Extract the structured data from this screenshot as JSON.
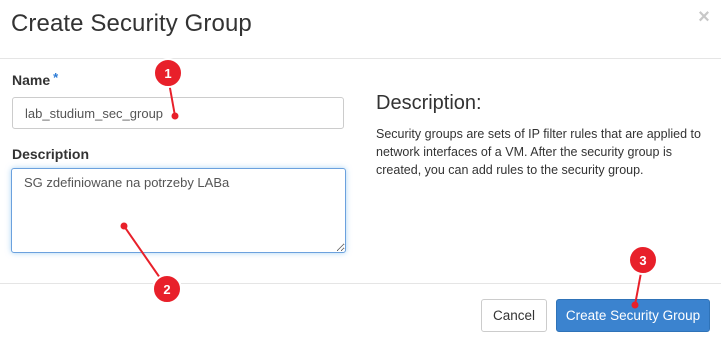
{
  "modal": {
    "title": "Create Security Group",
    "close_icon": "close-icon"
  },
  "form": {
    "name": {
      "label": "Name",
      "required_marker": "*",
      "value": "lab_studium_sec_group"
    },
    "description": {
      "label": "Description",
      "value": "SG zdefiniowane na potrzeby LABa"
    }
  },
  "help": {
    "heading": "Description:",
    "text": "Security groups are sets of IP filter rules that are applied to network interfaces of a VM. After the security group is created, you can add rules to the security group."
  },
  "footer": {
    "cancel_label": "Cancel",
    "submit_label": "Create Security Group"
  },
  "annotations": [
    {
      "number": "1",
      "color": "#e8202a"
    },
    {
      "number": "2",
      "color": "#e8202a"
    },
    {
      "number": "3",
      "color": "#e8202a"
    }
  ]
}
